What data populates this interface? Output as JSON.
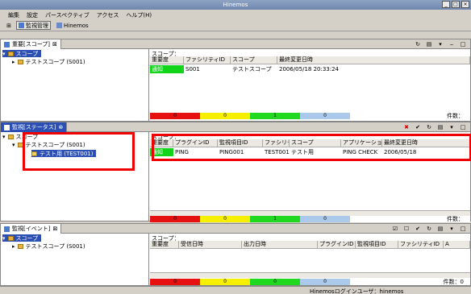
{
  "window": {
    "title": "Hinemos"
  },
  "menu": [
    "編集",
    "設定",
    "パースペクティブ",
    "アクセス",
    "ヘルプ(H)"
  ],
  "perspectives": [
    {
      "label": "監視管理",
      "selected": true
    },
    {
      "label": "Hinemos",
      "selected": false
    }
  ],
  "scope_view": {
    "tab": "重要[スコープ]",
    "tree_root": "スコープ",
    "tree_child": "テストスコープ (S001)",
    "scope_label": "スコープ：",
    "columns": [
      "重要度",
      "ファシリティID",
      "スコープ",
      "最終変更日時"
    ],
    "row": [
      "通知",
      "S001",
      "テストスコープ",
      "2006/05/18 20:33:24"
    ],
    "counts": [
      "0",
      "0",
      "1",
      "0"
    ],
    "count_label": "件数："
  },
  "status_view": {
    "tab": "監視[ステータス]",
    "tree_root": "スコープ",
    "tree_child": "テストスコープ (S001)",
    "tree_leaf": "テスト用 (TEST001)",
    "scope_label": "スコープ：",
    "columns": [
      "重要度",
      "プラグインID",
      "監視項目ID",
      "ファシリティID",
      "スコープ",
      "アプリケーション",
      "最終変更日時"
    ],
    "row": [
      "通知",
      "PING",
      "PING001",
      "TEST001",
      "テスト用",
      "PING CHECK",
      "2006/05/18"
    ],
    "counts": [
      "0",
      "0",
      "1",
      "0"
    ],
    "count_label": "件数："
  },
  "event_view": {
    "tab": "監視[イベント]",
    "tree_root": "スコープ",
    "tree_child": "テストスコープ (S001)",
    "scope_label": "スコープ：",
    "columns": [
      "重要度",
      "受信日時",
      "出力日時",
      "プラグインID",
      "監視項目ID",
      "ファシリティID",
      "A"
    ],
    "counts": [
      "0",
      "0",
      "0",
      "0"
    ],
    "count_label": "件数：0"
  },
  "statusline": {
    "user": "Hinemosログインユーザ：hinemos"
  },
  "colors": {
    "critical": "#e61010",
    "warning": "#f6f000",
    "info": "#1fd81f",
    "unknown": "#abc9ea",
    "highlight": "#ee0000"
  }
}
